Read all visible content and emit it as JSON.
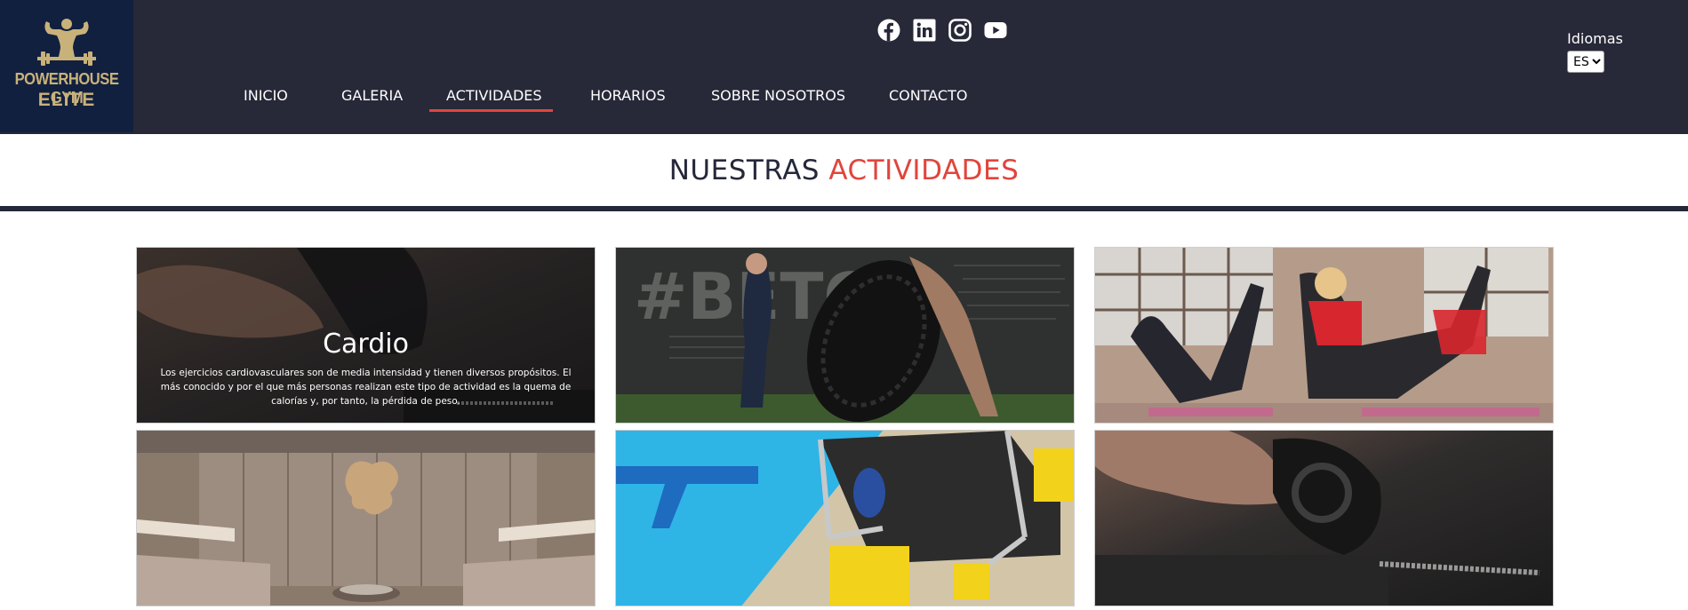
{
  "header": {
    "logo": {
      "line1": "POWERHOUSE GYM",
      "line2": "ELITE"
    },
    "social": [
      {
        "name": "facebook-icon"
      },
      {
        "name": "linkedin-icon"
      },
      {
        "name": "instagram-icon"
      },
      {
        "name": "youtube-icon"
      }
    ],
    "nav": [
      {
        "label": "INICIO"
      },
      {
        "label": "GALERIA"
      },
      {
        "label": "ACTIVIDADES",
        "active": true
      },
      {
        "label": "HORARIOS"
      },
      {
        "label": "SOBRE NOSOTROS"
      },
      {
        "label": "CONTACTO"
      }
    ],
    "language": {
      "label": "Idiomas",
      "selected": "ES"
    }
  },
  "section": {
    "title_part1": "NUESTRAS",
    "title_part2": "ACTIVIDADES"
  },
  "activities": [
    {
      "title": "Cardio",
      "description": "Los ejercicios cardiovasculares son de media intensidad y tienen diversos propósitos. El más conocido y por el que más personas realizan este tipo de actividad es la quema de calorías y, por tanto, la pérdida de peso."
    },
    {
      "title": "",
      "description": ""
    },
    {
      "title": "",
      "description": ""
    },
    {
      "title": "",
      "description": ""
    },
    {
      "title": "",
      "description": ""
    },
    {
      "title": "",
      "description": ""
    }
  ],
  "colors": {
    "header_bg": "#272838",
    "logo_bg": "#12203f",
    "logo_gold": "#c9b27a",
    "accent": "#e0453c",
    "text_dark": "#252839"
  }
}
